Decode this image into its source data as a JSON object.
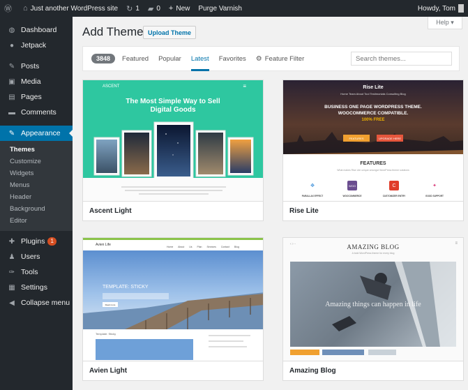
{
  "admin_bar": {
    "site_name": "Just another WordPress site",
    "updates": "1",
    "comments": "0",
    "new_label": "New",
    "purge_label": "Purge Varnish",
    "howdy": "Howdy, Tom"
  },
  "sidebar": {
    "items": [
      {
        "label": "Dashboard",
        "icon": "dashboard-icon",
        "glyph": "◍"
      },
      {
        "label": "Jetpack",
        "icon": "jetpack-icon",
        "glyph": "●"
      },
      {
        "label": "Posts",
        "icon": "pin-icon",
        "glyph": "✎"
      },
      {
        "label": "Media",
        "icon": "media-icon",
        "glyph": "▣"
      },
      {
        "label": "Pages",
        "icon": "pages-icon",
        "glyph": "▤"
      },
      {
        "label": "Comments",
        "icon": "comment-icon",
        "glyph": "▬"
      },
      {
        "label": "Appearance",
        "icon": "brush-icon",
        "glyph": "✎"
      },
      {
        "label": "Plugins",
        "icon": "plug-icon",
        "glyph": "✚",
        "badge": "1"
      },
      {
        "label": "Users",
        "icon": "users-icon",
        "glyph": "♟"
      },
      {
        "label": "Tools",
        "icon": "wrench-icon",
        "glyph": "✑"
      },
      {
        "label": "Settings",
        "icon": "settings-icon",
        "glyph": "▦"
      },
      {
        "label": "Collapse menu",
        "icon": "collapse-icon",
        "glyph": "◀"
      }
    ],
    "appearance_submenu": [
      "Themes",
      "Customize",
      "Widgets",
      "Menus",
      "Header",
      "Background",
      "Editor"
    ],
    "current_item": "Appearance",
    "current_subitem": "Themes"
  },
  "header": {
    "help_label": "Help ▾",
    "title": "Add Themes",
    "upload_label": "Upload Theme"
  },
  "filters": {
    "count": "3848",
    "links": [
      "Featured",
      "Popular",
      "Latest",
      "Favorites"
    ],
    "active": "Latest",
    "feature_filter": "Feature Filter",
    "search_placeholder": "Search themes..."
  },
  "themes": [
    {
      "name": "Ascent Light",
      "screenshot": {
        "logo": "ASCENT",
        "headline_1": "The Most Simple Way to Sell",
        "headline_2": "Digital Goods"
      }
    },
    {
      "name": "Rise Lite",
      "screenshot": {
        "logo": "Rise Lite",
        "nav": "Home   Team   About   Tool   Testimonials   Consulting   Blog",
        "headline_1": "BUSINESS ONE PAGE WORDPRESS THEME.",
        "headline_2": "WOOCOMMERCE COMPATIBLE.",
        "free": "100% FREE",
        "btn_features": "FEATURES",
        "btn_upgrade": "UPGRADE HERE",
        "features_title": "FEATURES",
        "features_sub": "What makes Rise Lite unique amongst WordPress theme solutions",
        "icon_labels": [
          "PARALLAX EFFECT",
          "WOOCOMMERCE",
          "CUSTOMIZER ENTRY",
          "GOOD SUPPORT"
        ]
      }
    },
    {
      "name": "Avien Light",
      "screenshot": {
        "logo": "Avien Life",
        "nav": "Home About Us Plan Services Contact Blog",
        "headline": "TEMPLATE: STICKY",
        "button": "Read more",
        "template_label": "Template: Sticky"
      }
    },
    {
      "name": "Amazing Blog",
      "screenshot": {
        "title": "AMAZING BLOG",
        "tagline": "A bold WordPress theme for every blog",
        "caption": "Amazing things can happen in life"
      }
    }
  ]
}
